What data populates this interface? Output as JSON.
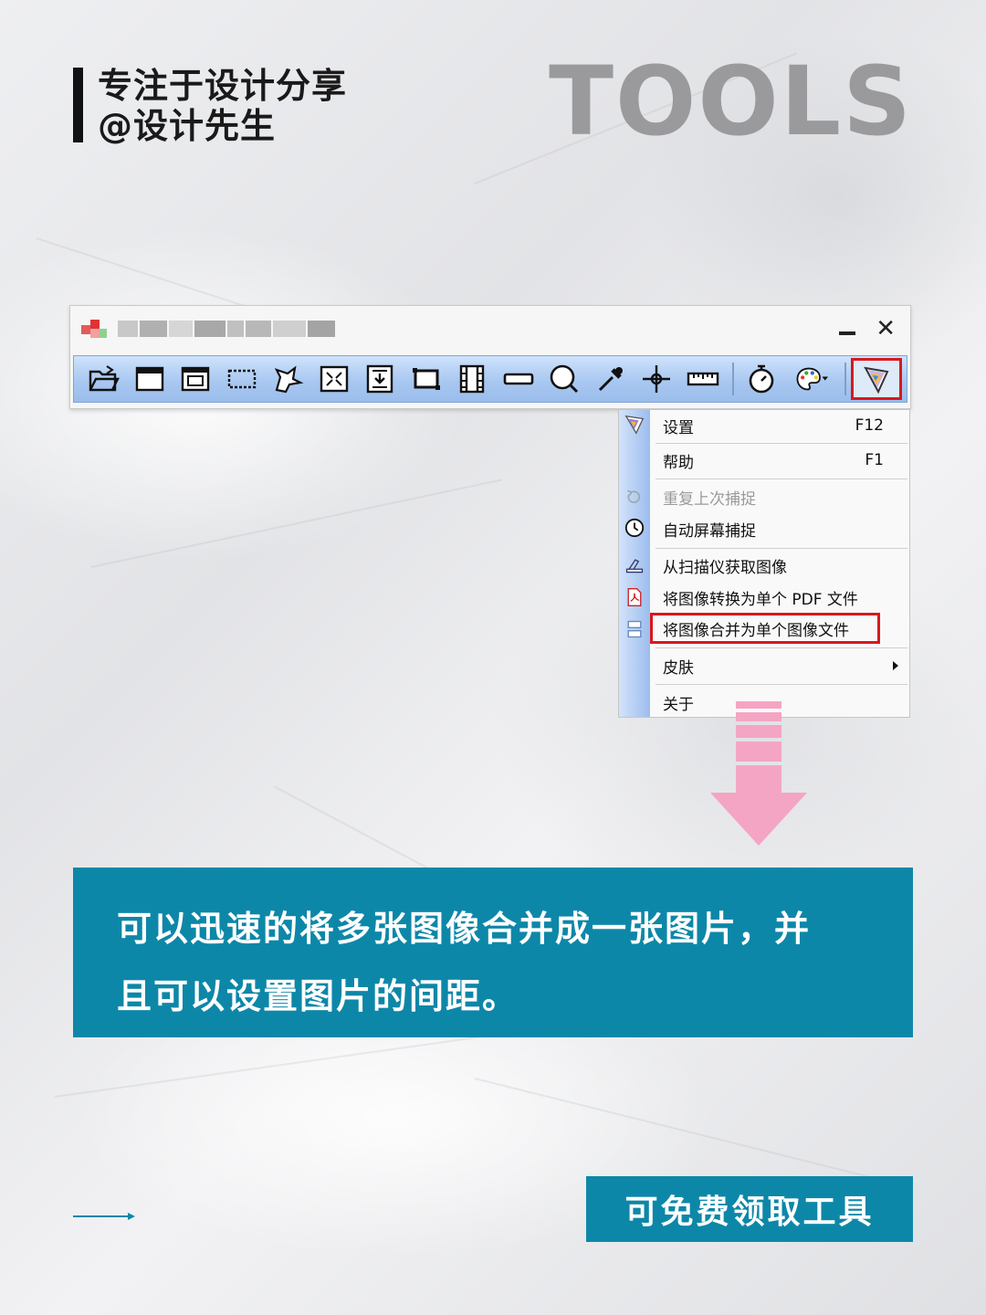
{
  "header": {
    "line1": "专注于设计分享",
    "line2": "@设计先生",
    "tools_word": "TOOLS"
  },
  "window": {
    "minimize_label": "–",
    "close_label": "✕",
    "toolbar_icons": [
      "open-folder-icon",
      "capture-window-icon",
      "capture-object-icon",
      "capture-region-icon",
      "freehand-capture-icon",
      "fullscreen-capture-icon",
      "scrolling-window-icon",
      "fixed-region-icon",
      "video-capture-icon",
      "ruler-bar-icon",
      "magnifier-icon",
      "color-picker-icon",
      "crosshair-icon",
      "screen-ruler-icon",
      "timer-icon",
      "palette-icon",
      "app-menu-icon"
    ]
  },
  "menu": {
    "items": [
      {
        "label": "设置",
        "key": "F12",
        "icon": "app-logo-icon"
      },
      {
        "label": "帮助",
        "key": "F1",
        "icon": ""
      },
      {
        "label": "重复上次捕捉",
        "key": "",
        "icon": "repeat-icon",
        "disabled": true
      },
      {
        "label": "自动屏幕捕捉",
        "key": "",
        "icon": "clock-icon"
      },
      {
        "label": "从扫描仪获取图像",
        "key": "",
        "icon": "scanner-icon"
      },
      {
        "label": "将图像转换为单个 PDF 文件",
        "key": "",
        "icon": "pdf-icon"
      },
      {
        "label": "将图像合并为单个图像文件",
        "key": "",
        "icon": "merge-images-icon"
      },
      {
        "label": "皮肤",
        "key": "",
        "icon": ""
      },
      {
        "label": "关于",
        "key": "",
        "icon": ""
      }
    ]
  },
  "description": {
    "line1": "可以迅速的将多张图像合并成一张图片，并",
    "line2": "且可以设置图片的间距。"
  },
  "footer": {
    "cta_label": "可免费领取工具"
  },
  "colors": {
    "accent": "#0d87a8",
    "highlight_red": "#d8181f",
    "arrow_pink": "#f4a5c3"
  }
}
